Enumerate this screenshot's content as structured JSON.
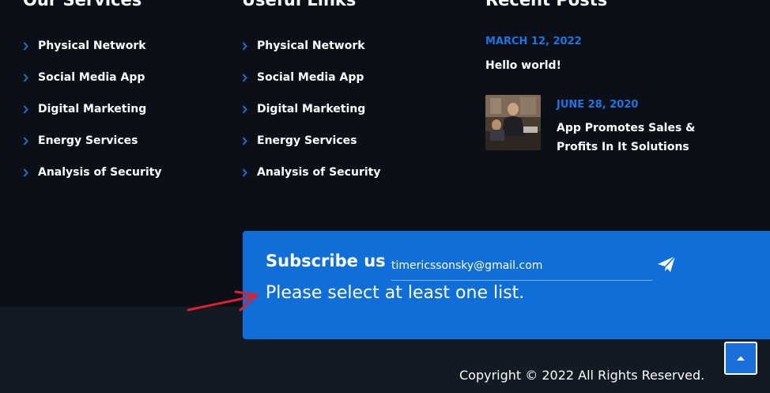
{
  "services": {
    "title": "Our Services",
    "items": [
      "Physical Network",
      "Social Media App",
      "Digital Marketing",
      "Energy Services",
      "Analysis of Security"
    ]
  },
  "useful_links": {
    "title": "Useful Links",
    "items": [
      "Physical Network",
      "Social Media App",
      "Digital Marketing",
      "Energy Services",
      "Analysis of Security"
    ]
  },
  "recent_posts": {
    "title": "Recent Posts",
    "posts": [
      {
        "date": "MARCH 12, 2022",
        "title": "Hello world!"
      },
      {
        "date": "JUNE 28, 2020",
        "title": "App Promotes Sales & Profits In It Solutions"
      }
    ]
  },
  "subscribe": {
    "title": "Subscribe us",
    "email_value": "timericssonsky@gmail.com",
    "message": "Please select at least one list."
  },
  "footer": {
    "copyright": "Copyright © 2022 All Rights Reserved."
  },
  "colors": {
    "accent": "#0f6ed8",
    "date_blue": "#1e74e0",
    "annotation_red": "#e0202a"
  },
  "icons": {
    "list_bullet": "chevron-right-icon",
    "send": "paper-plane-icon",
    "back_to_top": "chevron-up-icon"
  }
}
